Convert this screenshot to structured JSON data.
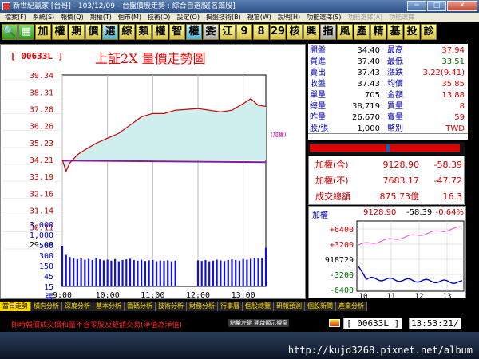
{
  "window": {
    "title": "新世紀贏家 [台哥] - 103/12/09 - 台盤價股走勢 : 綜合自選股[名篇股]",
    "buttons": {
      "minimize": "─",
      "maximize": "□",
      "close": "✕"
    }
  },
  "menu": [
    {
      "label": "檔案(F)",
      "dim": false
    },
    {
      "label": "系統(S)",
      "dim": false
    },
    {
      "label": "報價(Q)",
      "dim": false
    },
    {
      "label": "期權(T)",
      "dim": false
    },
    {
      "label": "個市(M)",
      "dim": false
    },
    {
      "label": "技術(D)",
      "dim": false
    },
    {
      "label": "設定(O)",
      "dim": false
    },
    {
      "label": "揭盤技術(B)",
      "dim": false
    },
    {
      "label": "視窗(W)",
      "dim": false
    },
    {
      "label": "說明(H)",
      "dim": false
    },
    {
      "label": "功能選擇(S)",
      "dim": false
    },
    {
      "label": "功能選擇(A)",
      "dim": true
    },
    {
      "label": "功能選擇",
      "dim": true
    }
  ],
  "toolbar": [
    {
      "label": "🔍",
      "style": "green",
      "name": "search-tool-button"
    },
    {
      "label": "▦",
      "style": "green",
      "name": "grid-tool-button"
    },
    {
      "label": "加",
      "style": "yellow",
      "name": "add-tool-button"
    },
    {
      "label": "權",
      "style": "yellow",
      "name": "weight-tool-button"
    },
    {
      "label": "期",
      "style": "yellow",
      "name": "futures-tool-button"
    },
    {
      "label": "價",
      "style": "yellow",
      "name": "price-tool-button"
    },
    {
      "label": "選",
      "style": "cyan",
      "name": "select-tool-button"
    },
    {
      "label": "綜",
      "style": "yellow",
      "name": "composite-tool-button"
    },
    {
      "label": "類",
      "style": "yellow",
      "name": "category-tool-button"
    },
    {
      "label": "權",
      "style": "yellow",
      "name": "warrant-tool-button"
    },
    {
      "label": "智",
      "style": "yellow",
      "name": "smart-tool-button"
    },
    {
      "label": "權",
      "style": "cyan",
      "name": "rights-tool-button"
    },
    {
      "label": "委",
      "style": "gray",
      "name": "order-tool-button"
    },
    {
      "label": "江",
      "style": "yellow",
      "name": "river-tool-button"
    },
    {
      "label": "9",
      "style": "yellow",
      "name": "nine-tool-button"
    },
    {
      "label": "8",
      "style": "yellow",
      "name": "eight-tool-button"
    },
    {
      "label": "29",
      "style": "yellow",
      "name": "twentynine-tool-button"
    },
    {
      "label": "核",
      "style": "yellow",
      "name": "core-tool-button"
    },
    {
      "label": "興",
      "style": "yellow",
      "name": "emerging-tool-button"
    },
    {
      "label": "指",
      "style": "gray",
      "name": "index-tool-button"
    },
    {
      "label": "風",
      "style": "yellow",
      "name": "style-tool-button"
    },
    {
      "label": "產",
      "style": "yellow",
      "name": "industry-tool-button"
    },
    {
      "label": "精",
      "style": "yellow",
      "name": "fine-tool-button"
    },
    {
      "label": "基",
      "style": "yellow",
      "name": "fund-tool-button"
    },
    {
      "label": "投",
      "style": "yellow",
      "name": "invest-tool-button"
    },
    {
      "label": "診",
      "style": "yellow",
      "name": "diagnose-tool-button"
    }
  ],
  "chart": {
    "code_label": "[ 00633L ]",
    "title": "上証2X  量價走勢圖",
    "side_label": "(加權)"
  },
  "chart_data": {
    "type": "line",
    "price_axis_ticks": [
      "39.34",
      "38.31",
      "37.28",
      "36.26",
      "35.23",
      "34.21",
      "33.19",
      "32.16",
      "31.14",
      "30.11",
      "29.08"
    ],
    "volume_axis_ticks": [
      "3,000",
      "1,000",
      "500",
      "300",
      "150",
      "45",
      "15",
      "張"
    ],
    "x_ticks": [
      "9:00",
      "10:00",
      "11:00",
      "12:00",
      "13:00"
    ],
    "reference_price": 34.21,
    "ylim": [
      29.08,
      39.34
    ],
    "price_series": [
      [
        "9:00",
        34.2
      ],
      [
        "9:05",
        33.5
      ],
      [
        "9:10",
        34.0
      ],
      [
        "9:20",
        34.5
      ],
      [
        "9:30",
        34.8
      ],
      [
        "9:45",
        35.2
      ],
      [
        "10:00",
        35.5
      ],
      [
        "10:15",
        35.8
      ],
      [
        "10:30",
        36.3
      ],
      [
        "10:45",
        36.8
      ],
      [
        "11:00",
        37.0
      ],
      [
        "11:15",
        37.0
      ],
      [
        "11:30",
        37.2
      ],
      [
        "12:00",
        37.3
      ],
      [
        "12:30",
        37.1
      ],
      [
        "12:45",
        37.2
      ],
      [
        "13:00",
        37.6
      ],
      [
        "13:10",
        37.9
      ],
      [
        "13:20",
        37.5
      ],
      [
        "13:30",
        37.43
      ]
    ],
    "trend_line": [
      [
        "9:00",
        34.15
      ],
      [
        "13:30",
        34.05
      ]
    ],
    "volume_series": [
      [
        "9:00",
        1000
      ],
      [
        "9:05",
        600
      ],
      [
        "9:10",
        520
      ],
      [
        "9:15",
        480
      ],
      [
        "9:20",
        450
      ],
      [
        "9:25",
        470
      ],
      [
        "9:30",
        430
      ],
      [
        "9:35",
        460
      ],
      [
        "9:40",
        420
      ],
      [
        "9:45",
        500
      ],
      [
        "9:50",
        440
      ],
      [
        "9:55",
        410
      ],
      [
        "10:00",
        430
      ],
      [
        "10:05",
        400
      ],
      [
        "10:10",
        450
      ],
      [
        "10:15",
        380
      ],
      [
        "10:20",
        420
      ],
      [
        "10:25",
        440
      ],
      [
        "10:30",
        460
      ],
      [
        "10:35",
        420
      ],
      [
        "10:40",
        400
      ],
      [
        "10:45",
        430
      ],
      [
        "10:50",
        390
      ],
      [
        "10:55",
        410
      ],
      [
        "11:00",
        420
      ],
      [
        "11:05",
        380
      ],
      [
        "11:10",
        400
      ],
      [
        "11:15",
        390
      ],
      [
        "11:20",
        410
      ],
      [
        "11:25",
        380
      ],
      [
        "11:30",
        400
      ],
      [
        "12:00",
        410
      ],
      [
        "12:05",
        390
      ],
      [
        "12:10",
        420
      ],
      [
        "12:15",
        380
      ],
      [
        "12:20",
        400
      ],
      [
        "12:25",
        430
      ],
      [
        "12:30",
        410
      ],
      [
        "12:35",
        390
      ],
      [
        "12:40",
        420
      ],
      [
        "12:45",
        440
      ],
      [
        "12:50",
        420
      ],
      [
        "12:55",
        400
      ],
      [
        "13:00",
        450
      ],
      [
        "13:05",
        430
      ],
      [
        "13:10",
        460
      ],
      [
        "13:15",
        480
      ],
      [
        "13:20",
        470
      ],
      [
        "13:25",
        500
      ],
      [
        "13:30",
        900
      ]
    ]
  },
  "quote": [
    {
      "l1": "開盤",
      "v1": "34.40",
      "l2": "最高",
      "v2": "37.94",
      "c2": "red"
    },
    {
      "l1": "買進",
      "v1": "37.40",
      "l2": "最低",
      "v2": "33.51",
      "c2": "green"
    },
    {
      "l1": "賣出",
      "v1": "37.43",
      "l2": "漲跌",
      "v2": "3.22(9.41)",
      "c2": "red"
    },
    {
      "l1": "收盤",
      "v1": "37.43",
      "l2": "均價",
      "v2": "35.85",
      "c2": "red"
    },
    {
      "l1": "單量",
      "v1": "705",
      "l2": "金額",
      "v2": "13.88",
      "c2": "red"
    },
    {
      "l1": "總量",
      "v1": "38,719",
      "l2": "買量",
      "v2": "8",
      "c2": "red"
    },
    {
      "l1": "昨量",
      "v1": "26,670",
      "l2": "賣量",
      "v2": "59",
      "c2": "red"
    },
    {
      "l1": "股/張",
      "v1": "1,000",
      "l2": "幣別",
      "v2": "TWD",
      "c2": "red"
    }
  ],
  "totals": [
    {
      "label": "加權(含)",
      "value": "9128.90",
      "change": "-58.39"
    },
    {
      "label": "加權(不)",
      "value": "7683.17",
      "change": "-47.72"
    },
    {
      "label": "成交總額",
      "value": "875.73億",
      "change": "16.3"
    }
  ],
  "mini": {
    "label": "加權",
    "value": "9128.90",
    "change": "-58.39",
    "pct": "-0.64%",
    "y_ticks": [
      "+6400",
      "+3200",
      "918729",
      "-3200",
      "-6400"
    ],
    "x_ticks": [
      "10",
      "11",
      "12",
      "13"
    ]
  },
  "tabs": [
    {
      "label": "當日走勢",
      "active": true
    },
    {
      "label": "橫向分析",
      "active": false
    },
    {
      "label": "深度分析",
      "active": false
    },
    {
      "label": "基本分析",
      "active": false
    },
    {
      "label": "籌碼分析",
      "active": false
    },
    {
      "label": "技術分析",
      "active": false
    },
    {
      "label": "財務分析",
      "active": false
    },
    {
      "label": "行事曆",
      "active": false
    },
    {
      "label": "個股總覽",
      "active": false
    },
    {
      "label": "研報預測",
      "active": false
    },
    {
      "label": "個股新聞",
      "active": false
    },
    {
      "label": "產業分析",
      "active": false
    }
  ],
  "status": {
    "message": "即時報價成交價和量不含零股及鉅額交易(淨值為淨值)",
    "hint": "點擊左鍵 開啟顯示視窗",
    "code": "[ 00633L ]",
    "time": "13:53:21/"
  },
  "watermark": "http://kujd3268.pixnet.net/album",
  "colors": {
    "price_line": "#d00000",
    "fill": "#cfeeee",
    "volume": "#1010e0",
    "reference": "#8020a0"
  }
}
